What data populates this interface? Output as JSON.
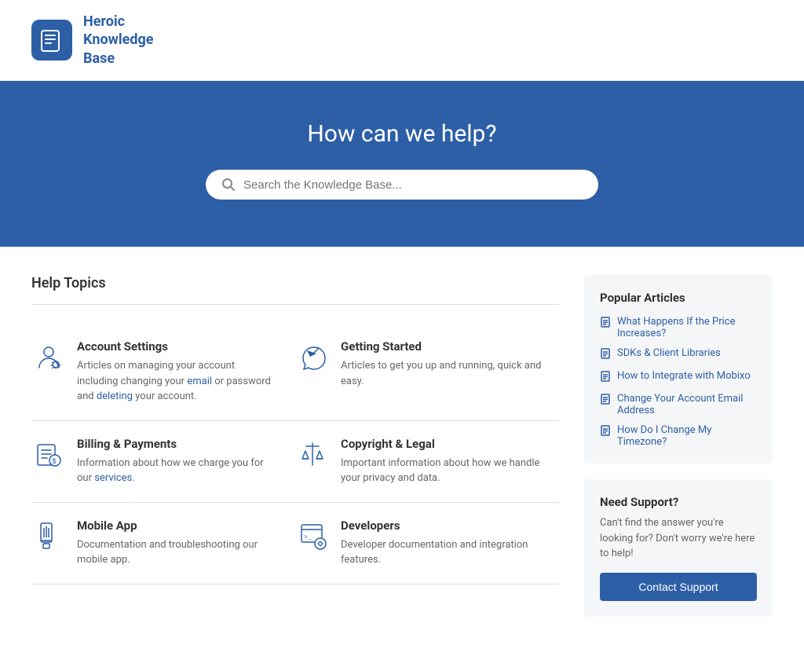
{
  "header": {
    "logo_alt": "Heroic Knowledge Base logo",
    "brand_line1": "Heroic",
    "brand_line2": "Knowledge",
    "brand_line3": "Base"
  },
  "hero": {
    "title": "How can we help?",
    "search_placeholder": "Search the Knowledge Base..."
  },
  "topics_section": {
    "heading": "Help Topics",
    "topics": [
      {
        "id": "account-settings",
        "title": "Account Settings",
        "description": "Articles on managing your account including changing your email or password and deleting your account.",
        "icon": "person-settings"
      },
      {
        "id": "getting-started",
        "title": "Getting Started",
        "description": "Articles to get you up and running, quick and easy.",
        "icon": "rocket"
      },
      {
        "id": "billing-payments",
        "title": "Billing & Payments",
        "description": "Information about how we charge you for our services.",
        "icon": "invoice"
      },
      {
        "id": "copyright-legal",
        "title": "Copyright & Legal",
        "description": "Important information about how we handle your privacy and data.",
        "icon": "gavel"
      },
      {
        "id": "mobile-app",
        "title": "Mobile App",
        "description": "Documentation and troubleshooting our mobile app.",
        "icon": "mobile"
      },
      {
        "id": "developers",
        "title": "Developers",
        "description": "Developer documentation and integration features.",
        "icon": "code-gear"
      }
    ]
  },
  "sidebar": {
    "popular_title": "Popular Articles",
    "articles": [
      {
        "text": "What Happens If the Price Increases?"
      },
      {
        "text": "SDKs & Client Libraries"
      },
      {
        "text": "How to Integrate with Mobixo"
      },
      {
        "text": "Change Your Account Email Address"
      },
      {
        "text": "How Do I Change My Timezone?"
      }
    ],
    "support_title": "Need Support?",
    "support_description": "Can't find the answer you're looking for? Don't worry we're here to help!",
    "contact_button": "Contact Support"
  }
}
